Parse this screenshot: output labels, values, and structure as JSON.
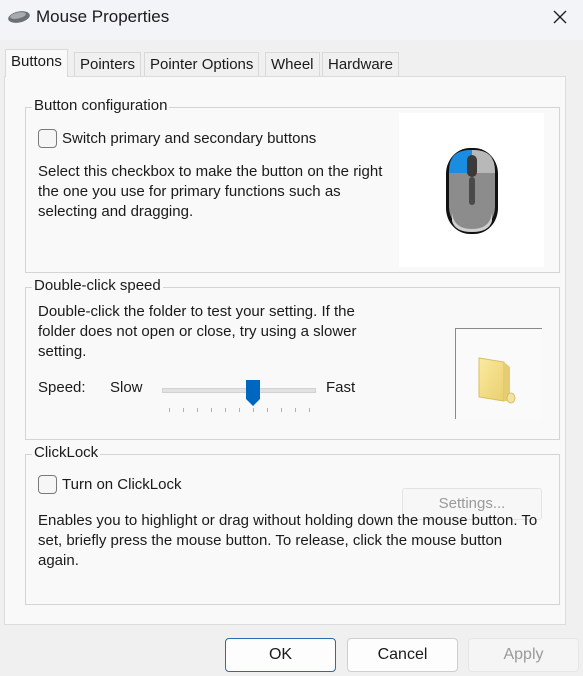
{
  "window": {
    "title": "Mouse Properties",
    "app_icon": "mouse-icon",
    "close_icon": "close-icon"
  },
  "tabs": [
    {
      "label": "Buttons",
      "active": true
    },
    {
      "label": "Pointers",
      "active": false
    },
    {
      "label": "Pointer Options",
      "active": false
    },
    {
      "label": "Wheel",
      "active": false
    },
    {
      "label": "Hardware",
      "active": false
    }
  ],
  "button_configuration": {
    "group_label": "Button configuration",
    "switch_checkbox_label": "Switch primary and secondary buttons",
    "switch_checked": false,
    "description": "Select this checkbox to make the button on the right the one you use for primary functions such as selecting and dragging.",
    "preview_icon": "mouse-left-button-highlighted-icon",
    "accent_color": "#1a8de0"
  },
  "double_click_speed": {
    "group_label": "Double-click speed",
    "description": "Double-click the folder to test your setting. If the folder does not open or close, try using a slower setting.",
    "speed_label": "Speed:",
    "slow_label": "Slow",
    "fast_label": "Fast",
    "slider_min": 0,
    "slider_max": 10,
    "slider_value": 6,
    "tick_count": 11,
    "test_icon": "folder-icon",
    "thumb_color": "#0067c0"
  },
  "clicklock": {
    "group_label": "ClickLock",
    "checkbox_label": "Turn on ClickLock",
    "checked": false,
    "settings_button": "Settings...",
    "settings_enabled": false,
    "description": "Enables you to highlight or drag without holding down the mouse button. To set, briefly press the mouse button. To release, click the mouse button again."
  },
  "footer": {
    "ok": "OK",
    "cancel": "Cancel",
    "apply": "Apply",
    "apply_enabled": false
  }
}
